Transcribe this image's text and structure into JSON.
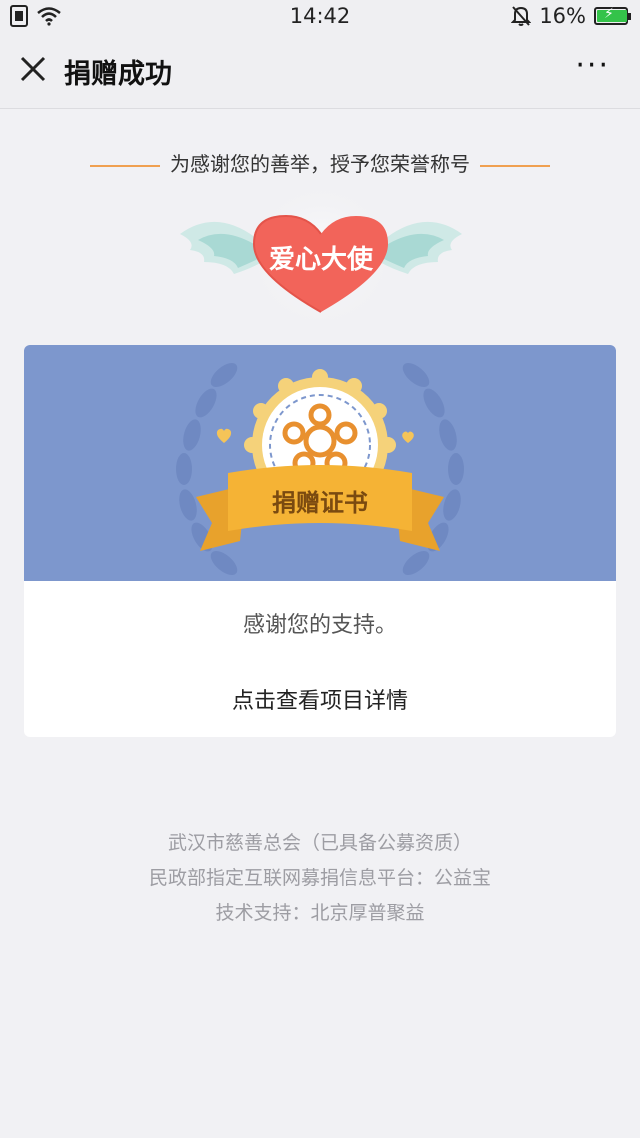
{
  "status": {
    "time": "14:42",
    "battery": "16%"
  },
  "nav": {
    "title": "捐赠成功",
    "more": "···"
  },
  "honor": {
    "text": "为感谢您的善举，授予您荣誉称号",
    "badge_label": "爱心大使"
  },
  "card": {
    "certificate_label": "捐赠证书",
    "thanks_text": "感谢您的支持。",
    "details_link": "点击查看项目详情"
  },
  "footer": {
    "line1": "武汉市慈善总会（已具备公募资质）",
    "line2": "民政部指定互联网募捐信息平台：公益宝",
    "line3": "技术支持：北京厚普聚益"
  },
  "colors": {
    "accent": "#f0a050",
    "heart": "#f2645a",
    "banner": "#7d97cd",
    "ribbon": "#f5b335"
  }
}
